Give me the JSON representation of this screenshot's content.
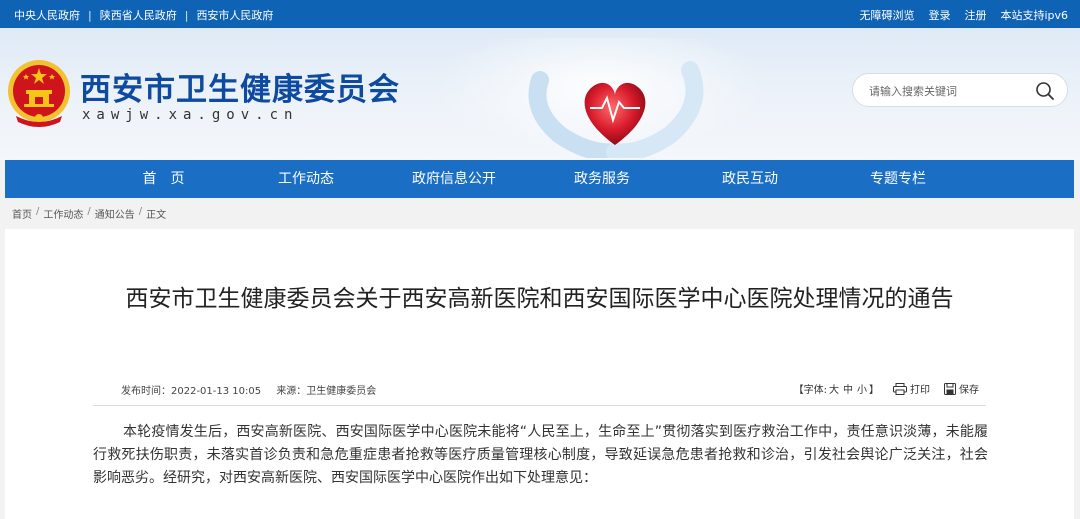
{
  "topbar": {
    "links": [
      "中央人民政府",
      "陕西省人民政府",
      "西安市人民政府"
    ],
    "separator": "|",
    "right_links": [
      "无障碍浏览",
      "登录",
      "注册",
      "本站支持ipv6"
    ]
  },
  "header": {
    "site_title": "西安市卫生健康委员会",
    "site_domain": "xawjw.xa.gov.cn",
    "search_placeholder": "请输入搜索关键词"
  },
  "nav": {
    "items": [
      "首　页",
      "工作动态",
      "政府信息公开",
      "政务服务",
      "政民互动",
      "专题专栏"
    ]
  },
  "breadcrumb": {
    "items": [
      "首页",
      "工作动态",
      "通知公告",
      "正文"
    ],
    "separator": "/"
  },
  "article": {
    "title": "西安市卫生健康委员会关于西安高新医院和西安国际医学中心医院处理情况的通告",
    "publish_time": "发布时间：2022-01-13 10:05",
    "source": "来源：卫生健康委员会",
    "font_label": "【字体:",
    "font_sizes": [
      "大",
      "中",
      "小"
    ],
    "font_close": "】",
    "print_label": "打印",
    "save_label": "保存",
    "body": "本轮疫情发生后，西安高新医院、西安国际医学中心医院未能将“人民至上，生命至上”贯彻落实到医疗救治工作中，责任意识淡薄，未能履行救死扶伤职责，未落实首诊负责和急危重症患者抢救等医疗质量管理核心制度，导致延误急危患者抢救和诊治，引发社会舆论广泛关注，社会影响恶劣。经研究，对西安高新医院、西安国际医学中心医院作出如下处理意见："
  },
  "colors": {
    "topbar_bg": "#0f63b4",
    "nav_bg": "#1a6fc4",
    "title_blue": "#0d4aa0",
    "emblem_red": "#d0141c",
    "emblem_gold": "#f5c518"
  },
  "icons": [
    "national-emblem-icon",
    "heart-hands-icon",
    "search-icon",
    "printer-icon",
    "save-icon"
  ]
}
